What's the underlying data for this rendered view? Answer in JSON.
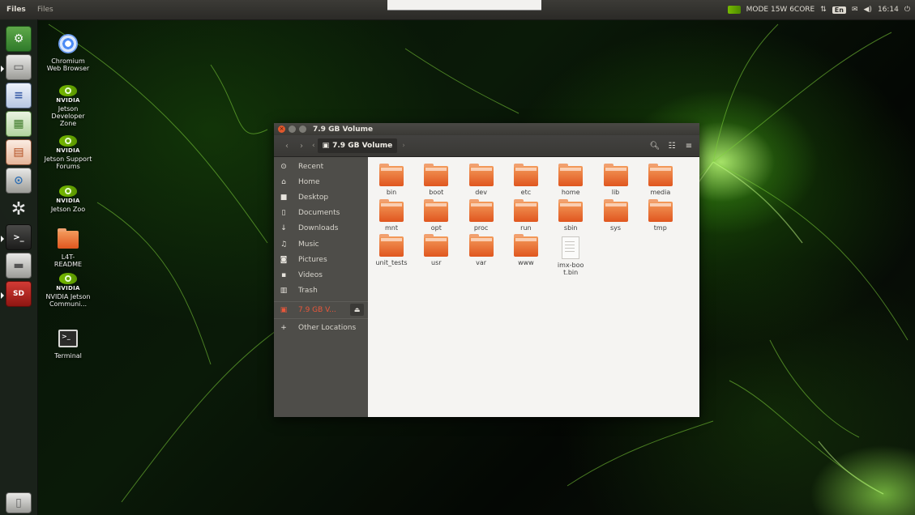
{
  "top_panel": {
    "app_name": "Files",
    "menu_label": "Files",
    "mode_text": "MODE 15W 6CORE",
    "keyboard_layout": "En",
    "clock": "16:14"
  },
  "launcher": {
    "items": [
      {
        "name": "system-settings-icon",
        "glyph": "⚙"
      },
      {
        "name": "files-icon",
        "glyph": "▭"
      },
      {
        "name": "writer-icon",
        "glyph": "≡"
      },
      {
        "name": "calc-icon",
        "glyph": "▦"
      },
      {
        "name": "impress-icon",
        "glyph": "▤"
      },
      {
        "name": "software-updater-icon",
        "glyph": "⊙"
      },
      {
        "name": "settings-icon",
        "glyph": "✲"
      },
      {
        "name": "terminal-icon",
        "glyph": ">_"
      },
      {
        "name": "drive-icon",
        "glyph": "▬"
      },
      {
        "name": "sd-card-icon",
        "glyph": "SD"
      },
      {
        "name": "trash-icon",
        "glyph": "▯"
      }
    ]
  },
  "desktop_icons": [
    {
      "label": "Chromium Web Browser",
      "icon": "chromium-icon"
    },
    {
      "label": "Jetson Developer Zone",
      "icon": "nvidia-icon",
      "brand": "NVIDIA"
    },
    {
      "label": "Jetson Support Forums",
      "icon": "nvidia-icon",
      "brand": "NVIDIA"
    },
    {
      "label": "Jetson Zoo",
      "icon": "nvidia-icon",
      "brand": "NVIDIA"
    },
    {
      "label": "L4T-README",
      "icon": "folder-icon"
    },
    {
      "label": "NVIDIA Jetson Communi...",
      "icon": "nvidia-icon",
      "brand": "NVIDIA"
    },
    {
      "label": "Terminal",
      "icon": "terminal-icon"
    }
  ],
  "window": {
    "title": "7.9 GB Volume",
    "breadcrumb_current": "7.9 GB Volume",
    "sidebar": {
      "items": [
        {
          "label": "Recent",
          "icon": "clock-icon",
          "glyph": "⊙"
        },
        {
          "label": "Home",
          "icon": "home-icon",
          "glyph": "⌂"
        },
        {
          "label": "Desktop",
          "icon": "desktop-icon",
          "glyph": "■"
        },
        {
          "label": "Documents",
          "icon": "documents-icon",
          "glyph": "▯"
        },
        {
          "label": "Downloads",
          "icon": "downloads-icon",
          "glyph": "↓"
        },
        {
          "label": "Music",
          "icon": "music-icon",
          "glyph": "♫"
        },
        {
          "label": "Pictures",
          "icon": "pictures-icon",
          "glyph": "◙"
        },
        {
          "label": "Videos",
          "icon": "videos-icon",
          "glyph": "▪"
        },
        {
          "label": "Trash",
          "icon": "trash-icon",
          "glyph": "▥"
        }
      ],
      "volume": {
        "label": "7.9 GB V...",
        "icon": "drive-icon",
        "glyph": "▣"
      },
      "other_locations": {
        "label": "Other Locations",
        "icon": "plus-icon",
        "glyph": "+"
      }
    },
    "files": [
      {
        "name": "bin",
        "type": "folder"
      },
      {
        "name": "boot",
        "type": "folder"
      },
      {
        "name": "dev",
        "type": "folder"
      },
      {
        "name": "etc",
        "type": "folder"
      },
      {
        "name": "home",
        "type": "folder"
      },
      {
        "name": "lib",
        "type": "folder"
      },
      {
        "name": "media",
        "type": "folder"
      },
      {
        "name": "mnt",
        "type": "folder"
      },
      {
        "name": "opt",
        "type": "folder"
      },
      {
        "name": "proc",
        "type": "folder"
      },
      {
        "name": "run",
        "type": "folder"
      },
      {
        "name": "sbin",
        "type": "folder"
      },
      {
        "name": "sys",
        "type": "folder"
      },
      {
        "name": "tmp",
        "type": "folder"
      },
      {
        "name": "unit_tests",
        "type": "folder"
      },
      {
        "name": "usr",
        "type": "folder"
      },
      {
        "name": "var",
        "type": "folder"
      },
      {
        "name": "www",
        "type": "folder"
      },
      {
        "name": "imx-boot.bin",
        "type": "file"
      }
    ]
  },
  "colors": {
    "accent": "#e8573a",
    "nvidia_green": "#76b900",
    "folder_orange": "#e0561f"
  }
}
